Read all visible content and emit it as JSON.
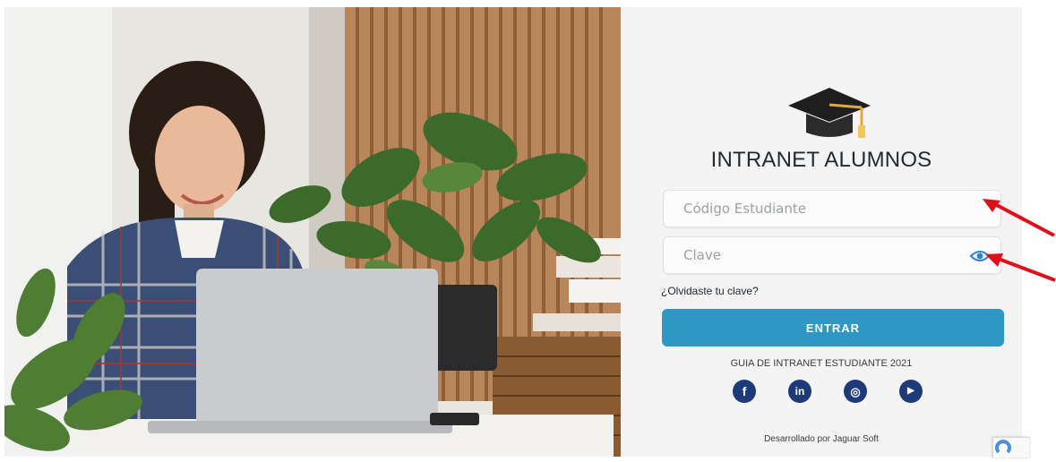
{
  "login": {
    "title": "INTRANET ALUMNOS",
    "student_code_placeholder": "Código Estudiante",
    "password_placeholder": "Clave",
    "forgot_label": "¿Olvidaste tu clave?",
    "submit_label": "ENTRAR",
    "guide_text": "GUIA DE INTRANET ESTUDIANTE 2021",
    "credit_text": "Desarrollado por Jaguar Soft"
  },
  "social": [
    {
      "icon": "facebook-icon",
      "glyph": "f"
    },
    {
      "icon": "linkedin-icon",
      "glyph": "in"
    },
    {
      "icon": "instagram-icon",
      "glyph": "◎"
    },
    {
      "icon": "youtube-icon",
      "glyph": "▶"
    }
  ],
  "colors": {
    "accent": "#2e97c4",
    "social": "#1e3a78",
    "annotation_arrow": "#e0101a",
    "panel_background": "#f4f4f4"
  }
}
